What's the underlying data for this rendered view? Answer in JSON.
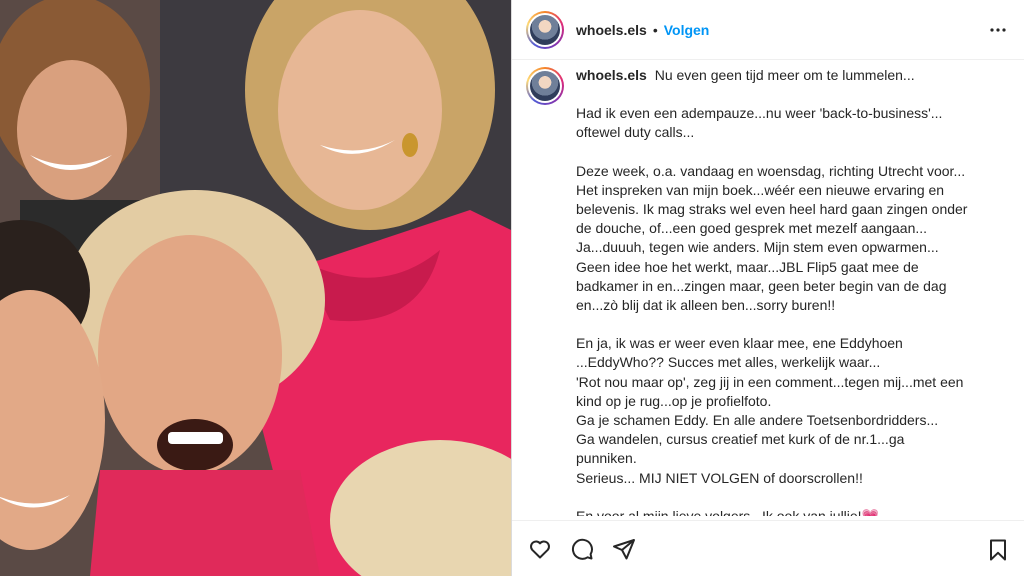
{
  "post": {
    "username": "whoels.els",
    "separator": "•",
    "follow_label": "Volgen"
  },
  "caption": {
    "username": "whoels.els",
    "first_line": "Nu even geen tijd meer om te lummelen...",
    "paragraphs": [
      "Had ik even een adempauze...nu weer 'back-to-business'...\noftewel duty calls...",
      "Deze week, o.a. vandaag en woensdag, richting Utrecht voor...\nHet inspreken van mijn boek...wéér een nieuwe ervaring en\nbelevenis. Ik mag straks wel even heel hard gaan zingen onder\nde douche, of...een goed gesprek met mezelf aangaan...\nJa...duuuh, tegen wie anders. Mijn stem even opwarmen...\nGeen idee hoe het werkt, maar...JBL Flip5 gaat mee de\nbadkamer in en...zingen maar, geen beter begin van de dag\nen...zò blij dat ik alleen ben...sorry buren!!",
      "En ja, ik was er weer even klaar mee, ene Eddyhoen\n...EddyWho?? Succes met alles, werkelijk waar...\n'Rot nou maar op', zeg jij in een comment...tegen mij...met een\nkind op je rug...op je profielfoto.\nGa je schamen Eddy. En alle andere Toetsenbordridders...\nGa wandelen, cursus creatief met kurk of de nr.1...ga\npunniken.\nSerieus... MIJ NIET VOLGEN of doorscrollen!!",
      "En voor al mijn lieve volgers...Ik ook van jullie!"
    ],
    "last_emoji": "💗"
  },
  "icons": {
    "like": "heart-icon",
    "comment": "comment-icon",
    "share": "share-icon",
    "save": "bookmark-icon",
    "more": "more-options-icon"
  },
  "colors": {
    "follow_blue": "#0095f6",
    "text": "#262626",
    "dress_pink": "#e8265e"
  }
}
